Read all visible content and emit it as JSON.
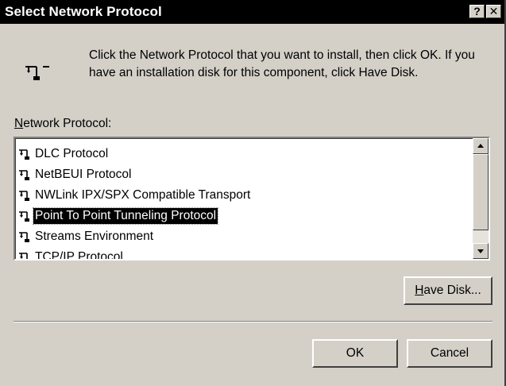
{
  "window": {
    "title": "Select Network Protocol",
    "help_glyph": "?",
    "close_glyph": "✕"
  },
  "instructions": "Click the Network Protocol that you want to install, then click OK.  If you have an installation disk for this component, click Have Disk.",
  "list": {
    "label_accel": "N",
    "label_rest": "etwork Protocol:",
    "items": [
      "DLC Protocol",
      "NetBEUI Protocol",
      "NWLink IPX/SPX Compatible Transport",
      "Point To Point Tunneling Protocol",
      "Streams Environment",
      "TCP/IP Protocol"
    ],
    "selected_index": 3
  },
  "buttons": {
    "have_disk_accel": "H",
    "have_disk_rest": "ave Disk...",
    "ok": "OK",
    "cancel": "Cancel"
  },
  "icons": {
    "header": "network-protocol-icon",
    "item": "protocol-icon",
    "scroll_up": "scroll-up-arrow-icon",
    "scroll_down": "scroll-down-arrow-icon"
  }
}
